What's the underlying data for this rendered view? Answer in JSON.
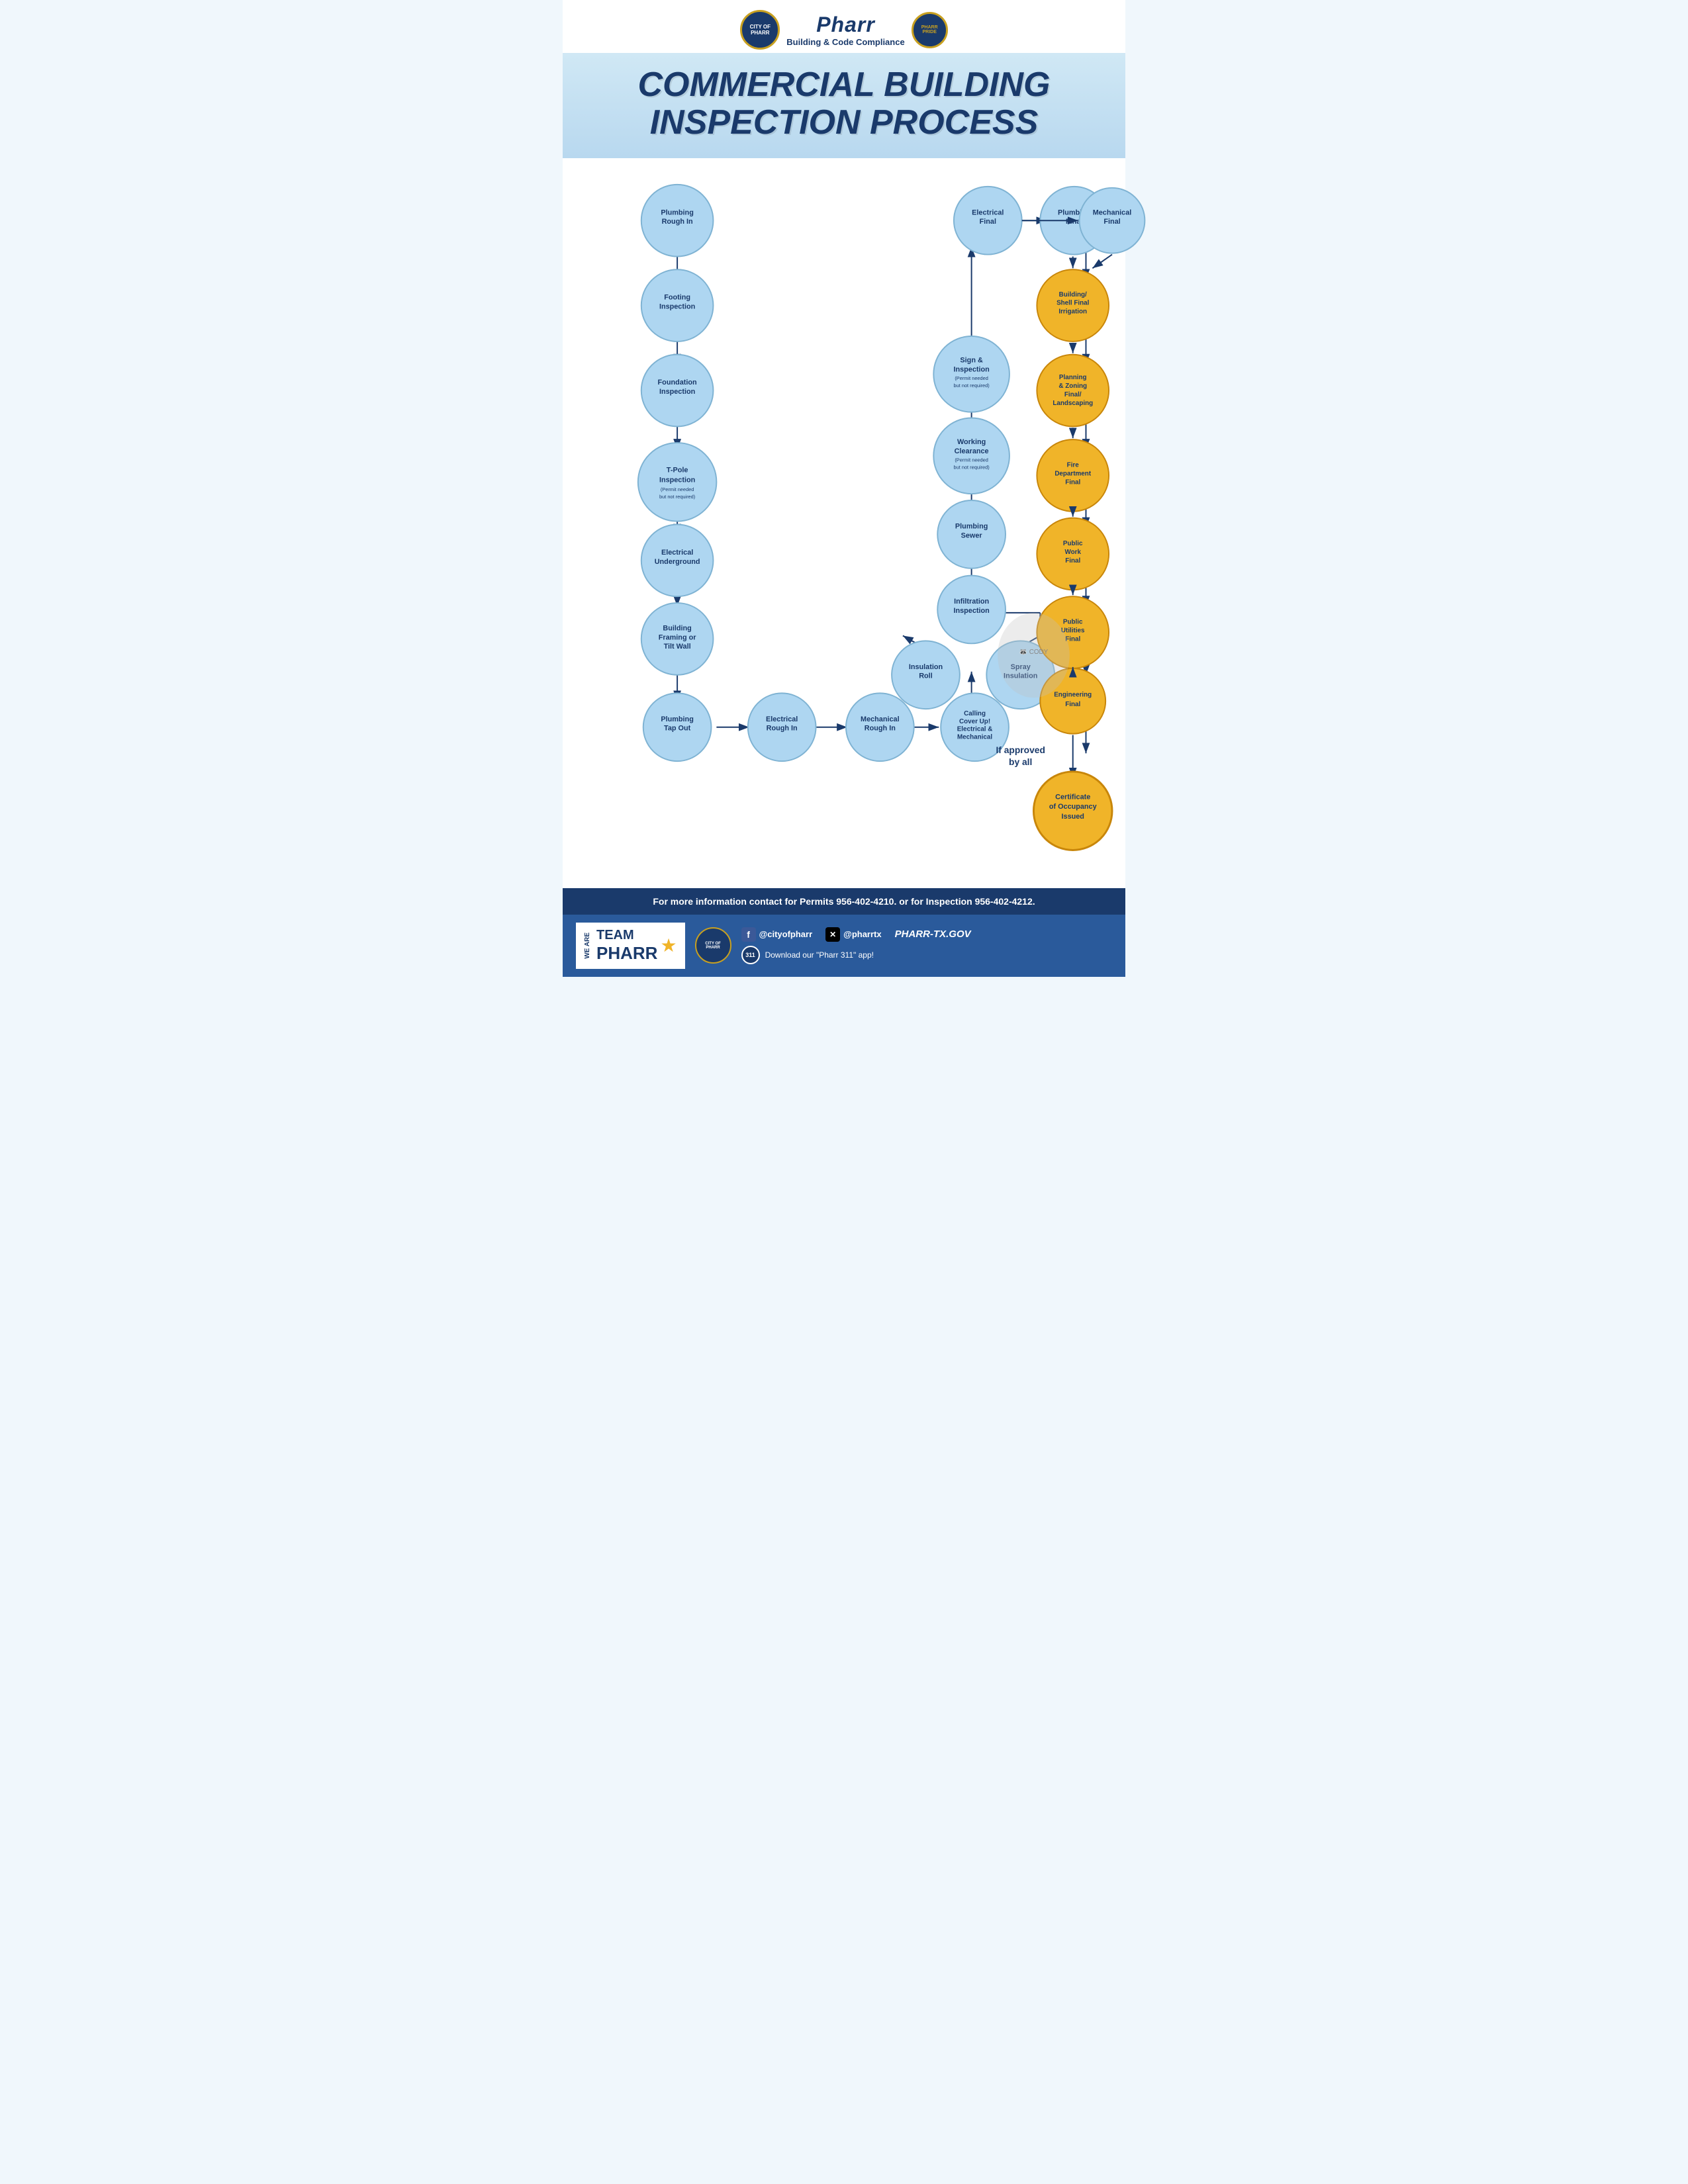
{
  "header": {
    "org_name": "Pharr",
    "subtitle": "Building & Code Compliance",
    "logo_text": "CITY OF PHARR",
    "pride_text": "PHARR PRIDE"
  },
  "title": {
    "line1": "COMMERCIAL BUILDING",
    "line2": "INSPECTION PROCESS"
  },
  "nodes": {
    "left_column": [
      {
        "id": "plumbing-rough-in",
        "label": "Plumbing\nRough In",
        "type": "blue"
      },
      {
        "id": "footing-inspection",
        "label": "Footing\nInspection",
        "type": "blue"
      },
      {
        "id": "foundation-inspection",
        "label": "Foundation\nInspection",
        "type": "blue"
      },
      {
        "id": "tpole-inspection",
        "label": "T-Pole\nInspection",
        "type": "blue",
        "note": "(Permit needed\nbut not required)"
      },
      {
        "id": "electrical-underground",
        "label": "Electrical\nUnderground",
        "type": "blue"
      },
      {
        "id": "building-framing",
        "label": "Building\nFraming or\nTilt Wall",
        "type": "blue"
      },
      {
        "id": "plumbing-tap-out",
        "label": "Plumbing\nTap Out",
        "type": "blue"
      }
    ],
    "bottom_row": [
      {
        "id": "electrical-rough-in",
        "label": "Electrical\nRough In",
        "type": "blue"
      },
      {
        "id": "mechanical-rough-in",
        "label": "Mechanical\nRough In",
        "type": "blue"
      },
      {
        "id": "calling-cover-up",
        "label": "Calling\nCover Up!\nElectrical &\nMechanical",
        "type": "blue"
      }
    ],
    "middle_column": [
      {
        "id": "electrical-final",
        "label": "Electrical\nFinal",
        "type": "blue"
      },
      {
        "id": "plumbing-final",
        "label": "Plumbing\nFinal",
        "type": "blue"
      },
      {
        "id": "sign-inspection",
        "label": "Sign &\nInspection",
        "type": "blue",
        "note": "(Permit needed\nbut not required)"
      },
      {
        "id": "working-clearance",
        "label": "Working\nClearance",
        "type": "blue",
        "note": "(Permit needed\nbut not required)"
      },
      {
        "id": "plumbing-sewer",
        "label": "Plumbing\nSewer",
        "type": "blue"
      },
      {
        "id": "infiltration-inspection",
        "label": "Infiltration\nInspection",
        "type": "blue"
      },
      {
        "id": "insulation-roll",
        "label": "Insulation\nRoll",
        "type": "blue"
      },
      {
        "id": "spray-insulation",
        "label": "Spray\nInsulation",
        "type": "blue"
      }
    ],
    "right_column": [
      {
        "id": "mechanical-final",
        "label": "Mechanical\nFinal",
        "type": "blue"
      },
      {
        "id": "building-shell-final",
        "label": "Building/\nShell Final\nIrrigation",
        "type": "gold"
      },
      {
        "id": "planning-zoning",
        "label": "Planning\n& Zoning\nFinal/\nLandscaping",
        "type": "gold"
      },
      {
        "id": "fire-department",
        "label": "Fire\nDepartment\nFinal",
        "type": "gold"
      },
      {
        "id": "public-work-final",
        "label": "Public\nWork\nFinal",
        "type": "gold"
      },
      {
        "id": "public-utilities",
        "label": "Public\nUtilities\nFinal",
        "type": "gold"
      },
      {
        "id": "engineering-final",
        "label": "Engineering\nFinal",
        "type": "gold"
      },
      {
        "id": "certificate",
        "label": "Certificate\nof Occupancy\nIssued",
        "type": "gold"
      }
    ]
  },
  "if_approved_text": "If approved\nby all",
  "footer": {
    "contact_text": "For more information contact for Permits 956-402-4210. or for Inspection 956-402-4212.",
    "we_are": "WE ARE",
    "team_pharr": "TEAM\nPHARR",
    "facebook_handle": "@cityofpharr",
    "twitter_handle": "@pharrtx",
    "website": "PHARR-TX.GOV",
    "app_text": "Download our \"Pharr 311\" app!",
    "app_badge": "311"
  }
}
